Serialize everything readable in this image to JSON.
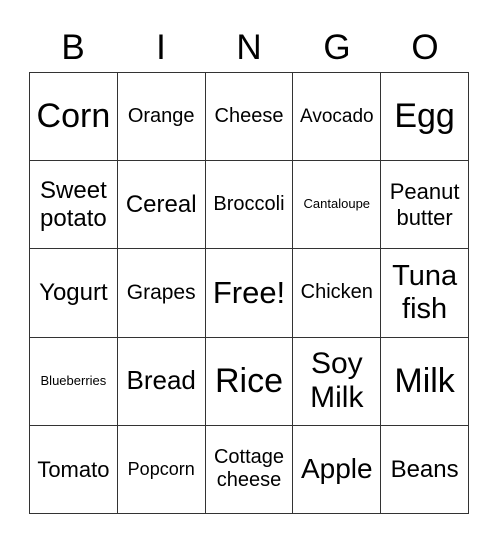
{
  "header": [
    "B",
    "I",
    "N",
    "G",
    "O"
  ],
  "cells": [
    "Corn",
    "Orange",
    "Cheese",
    "Avocado",
    "Egg",
    "Sweet potato",
    "Cereal",
    "Broccoli",
    "Cantaloupe",
    "Peanut butter",
    "Yogurt",
    "Grapes",
    "Free!",
    "Chicken",
    "Tuna fish",
    "Blueberries",
    "Bread",
    "Rice",
    "Soy Milk",
    "Milk",
    "Tomato",
    "Popcorn",
    "Cottage cheese",
    "Apple",
    "Beans"
  ]
}
